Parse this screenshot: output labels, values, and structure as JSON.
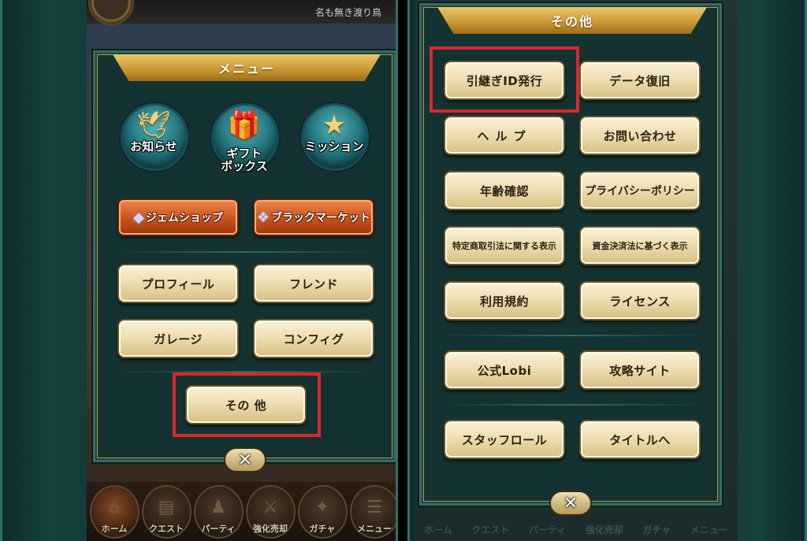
{
  "left_screen": {
    "player_name": "名も無き渡り鳥",
    "menu_title": "メニュー",
    "icon_buttons": [
      {
        "label": "お知らせ",
        "icon": "bird-icon"
      },
      {
        "label": "ギフト\nボックス",
        "icon": "gift-icon"
      },
      {
        "label": "ミッション",
        "icon": "star-badge-icon"
      }
    ],
    "shop_buttons": [
      {
        "label": "ジェムショップ",
        "icon": "gem-icon"
      },
      {
        "label": "ブラックマーケット",
        "icon": "black-market-icon"
      }
    ],
    "menu_buttons": [
      "プロフィール",
      "フレンド",
      "ガレージ",
      "コンフィグ"
    ],
    "other_button": "その 他",
    "close_symbol": "✕",
    "bottom_nav": [
      "ホーム",
      "クエスト",
      "パーティ",
      "強化売却",
      "ガチャ",
      "メニュー"
    ]
  },
  "right_screen": {
    "title": "その他",
    "buttons": [
      "引継ぎID発行",
      "データ復旧",
      "ヘルプ",
      "お問い合わせ",
      "年齢確認",
      "プライバシーポリシー",
      "特定商取引法に関する表示",
      "資金決済法に基づく表示",
      "利用規約",
      "ライセンス",
      "公式Lobi",
      "攻略サイト",
      "スタッフロール",
      "タイトルへ"
    ],
    "close_symbol": "✕",
    "bottom_nav": [
      "ホーム",
      "クエスト",
      "パーティ",
      "強化売却",
      "ガチャ",
      "メニュー"
    ]
  },
  "colors": {
    "highlight": "#d8282c",
    "panel": "#133231",
    "ribbon": "#c8952f",
    "button_beige": "#ecdcae",
    "shop_orange": "#c8521c"
  }
}
